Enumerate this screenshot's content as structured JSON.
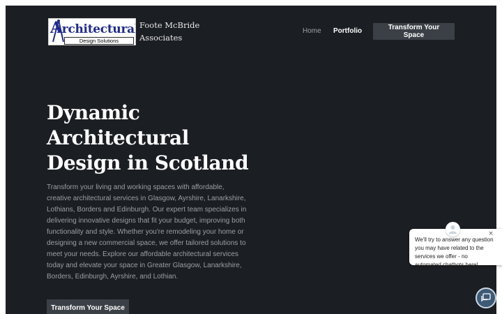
{
  "header": {
    "logo": {
      "title": "Architectural",
      "title_rest": "rchitectural",
      "title_initial": "A",
      "subtitle": "Design Solutions"
    },
    "company_name": "Foote McBride Associates",
    "nav": {
      "home": "Home",
      "portfolio": "Portfolio"
    },
    "cta": "Transform Your Space"
  },
  "hero": {
    "title": "Dynamic Architectural Design in Scotland",
    "description": "Transform your living and working spaces with affordable, creative architectural services in Glasgow, Ayrshire, Lanarkshire, Lothians, Borders and Edinburgh. Our expert team specializes in delivering innovative designs that fit your budget, improving both functionality and style. Whether you're remodeling your home or designing a new commercial space, we offer tailored solutions to meet your needs. Explore our affordable architectural services today and elevate your space in Greater Glasgow, Lanarkshire, Borders, Edinburgh, Ayrshire, and Lothian.",
    "cta": "Transform Your Space"
  },
  "chat": {
    "message": "We'll try to answer any question you may have related to the services we offer - no automated chatbots here!",
    "close_glyph": "×",
    "icons": {
      "avatar": "user-avatar-icon",
      "launcher": "chat-icon",
      "close": "close-icon"
    }
  },
  "colors": {
    "page_background": "#1b1e22",
    "button_background": "#3a4046",
    "logo_blue": "#1f2a8f",
    "launcher": "#3d5a76"
  }
}
